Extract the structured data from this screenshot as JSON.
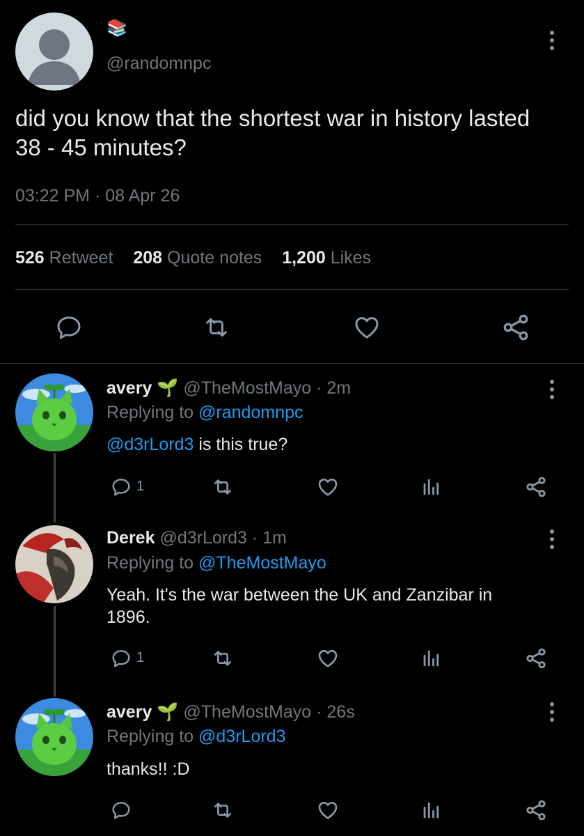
{
  "main_tweet": {
    "badge_emoji": "📚",
    "handle": "@randomnpc",
    "text_line1": "did you know that the shortest war in history lasted",
    "text_line2": "38 - 45 minutes?",
    "timestamp": "03:22 PM · 08 Apr 26",
    "stats": {
      "retweets_count": "526",
      "retweets_label": "Retweet",
      "quotes_count": "208",
      "quotes_label": "Quote notes",
      "likes_count": "1,200",
      "likes_label": "Likes"
    }
  },
  "replies": [
    {
      "name": "avery",
      "emoji": "🌱",
      "handle": "@TheMostMayo",
      "time": "· 2m",
      "replying_prefix": "Replying to",
      "replying_to": "@randomnpc",
      "mention": "@d3rLord3",
      "text": " is this true?",
      "reply_count": "1"
    },
    {
      "name": "Derek",
      "handle": "@d3rLord3",
      "time": "· 1m",
      "replying_prefix": "Replying to",
      "replying_to": "@TheMostMayo",
      "text_line1": "Yeah. It's the war between the UK and Zanzibar in",
      "text_line2": "1896.",
      "reply_count": "1"
    },
    {
      "name": "avery",
      "emoji": "🌱",
      "handle": "@TheMostMayo",
      "time": "· 26s",
      "replying_prefix": "Replying to",
      "replying_to": "@d3rLord3",
      "text": "thanks!! :D"
    }
  ],
  "colors": {
    "background": "#000000",
    "text": "#e7e9ea",
    "muted": "#71767b",
    "link": "#1d9bf0",
    "divider": "#2f3336"
  }
}
